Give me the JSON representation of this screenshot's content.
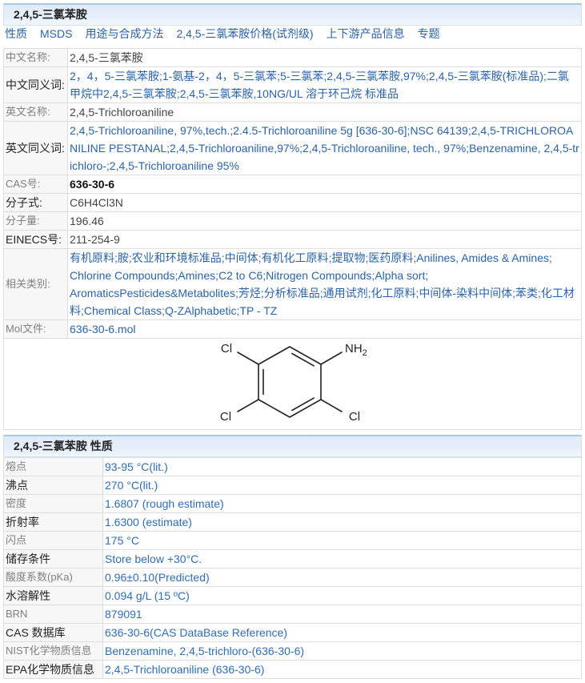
{
  "title": "2,4,5-三氯苯胺",
  "nav": {
    "properties": "性质",
    "msds": "MSDS",
    "uses_synthesis": "用途与合成方法",
    "price": "2,4,5-三氯苯胺价格(试剂级)",
    "supply_chain": "上下游产品信息",
    "topics": "专题"
  },
  "list_separator": ";",
  "basic": {
    "chinese_name": {
      "label": "中文名称:",
      "value": "2,4,5-三氯苯胺"
    },
    "chinese_synonyms": {
      "label": "中文同义词:",
      "values": [
        "2，4，5-三氯苯胺",
        "1-氨基-2，4，5-三氯苯",
        "5-三氯苯",
        "2,4,5-三氯苯胺,97%",
        "2,4,5-三氯苯胺(标准品)",
        "二氯甲烷中2,4,5-三氯苯胺",
        "2,4,5-三氯苯胺,10NG/UL 溶于环己烷 标准品"
      ]
    },
    "english_name": {
      "label": "英文名称:",
      "value": "2,4,5-Trichloroaniline"
    },
    "english_synonyms": {
      "label": "英文同义词:",
      "values": [
        "2,4,5-Trichloroaniline, 97%,tech.",
        "2.4.5-Trichloroaniline 5g [636-30-6]",
        "NSC 64139",
        "2,4,5-TRICHLOROANILINE PESTANAL",
        "2,4,5-Trichloroaniline,97%",
        "2,4,5-Trichloroaniline, tech., 97%",
        "Benzenamine, 2,4,5-trichloro-",
        "2,4,5-Trichloroaniline 95%"
      ]
    },
    "cas": {
      "label": "CAS号:",
      "value": "636-30-6"
    },
    "formula": {
      "label": "分子式:",
      "value": "C6H4Cl3N"
    },
    "molecular_weight": {
      "label": "分子量:",
      "value": "196.46"
    },
    "einecs": {
      "label": "EINECS号:",
      "value": "211-254-9"
    },
    "categories": {
      "label": "相关类别:",
      "values": [
        "有机原料",
        "胺",
        "农业和环境标准品",
        "中间体",
        "有机化工原料",
        "提取物",
        "医药原料",
        "Anilines, Amides & Amines",
        "Chlorine Compounds",
        "Amines",
        "C2 to C6",
        "Nitrogen Compounds",
        "Alpha sort",
        "AromaticsPesticides&Metabolites",
        "芳烃",
        "分析标准品",
        "通用试剂",
        "化工原料",
        "中间体-染料中间体",
        "苯类",
        "化工材料",
        "Chemical Class",
        "Q-ZAlphabetic",
        "TP - TZ"
      ]
    },
    "mol_file": {
      "label": "Mol文件:",
      "value": "636-30-6.mol"
    }
  },
  "structure": {
    "atoms": {
      "top_left": "Cl",
      "amine_main": "NH",
      "amine_sub": "2",
      "bottom_left": "Cl",
      "bottom_right": "Cl"
    }
  },
  "properties": {
    "title": "2,4,5-三氯苯胺 性质",
    "rows": [
      {
        "label": "熔点",
        "value": "93-95 °C(lit.)"
      },
      {
        "label": "沸点",
        "value": "270 °C(lit.)"
      },
      {
        "label": "密度",
        "value": "1.6807 (rough estimate)"
      },
      {
        "label": "折射率",
        "value": "1.6300 (estimate)"
      },
      {
        "label": "闪点",
        "value": "175 °C"
      },
      {
        "label": "储存条件",
        "value": "Store below +30°C."
      },
      {
        "label": "酸度系数(pKa)",
        "value": "0.96±0.10(Predicted)"
      },
      {
        "label": "水溶解性",
        "value": "0.094 g/L (15 ºC)"
      },
      {
        "label": "BRN",
        "value": "879091"
      },
      {
        "label": "CAS 数据库",
        "value": "636-30-6(CAS DataBase Reference)"
      },
      {
        "label": "NIST化学物质信息",
        "value": "Benzenamine, 2,4,5-trichloro-(636-30-6)"
      },
      {
        "label": "EPA化学物质信息",
        "value": "2,4,5-Trichloroaniline (636-30-6)"
      }
    ]
  },
  "colors": {
    "link": "#2a63a8",
    "property_value": "#2f6db5",
    "header_background": "#e6eff9",
    "header_border": "#a9c8e8",
    "label_background": "#f7f7f7",
    "muted_label": "#808080"
  }
}
